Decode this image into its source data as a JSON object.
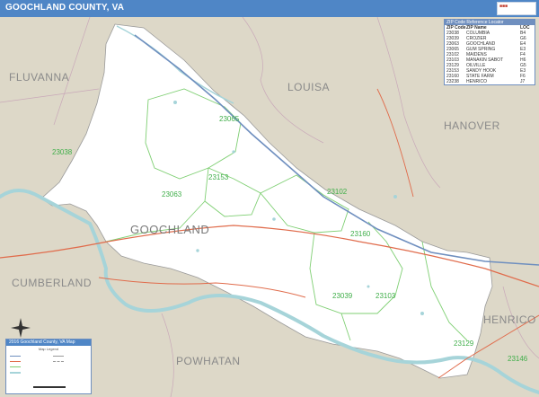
{
  "title": "GOOCHLAND COUNTY, VA",
  "colors": {
    "title_bar": "#4f86c6",
    "land": "#ddd8c8",
    "county_fill": "#ffffff",
    "water": "#a6d4d9",
    "zip_boundary": "#7fcf73",
    "highway": "#e06b4b",
    "interstate": "#6f8fbf"
  },
  "regions": [
    "FLUVANNA",
    "LOUISA",
    "HANOVER",
    "CUMBERLAND",
    "POWHATAN",
    "HENRICO"
  ],
  "county_label": "GOOCHLAND",
  "zip_codes": [
    "23038",
    "23063",
    "23065",
    "23153",
    "23102",
    "23160",
    "23039",
    "23103",
    "23129",
    "23146"
  ],
  "zip_table": {
    "heading": "ZIP Code Reference Locator",
    "columns": [
      "ZIP Code",
      "ZIP Name",
      "LOC"
    ],
    "rows": [
      [
        "23038",
        "COLUMBIA",
        "B4"
      ],
      [
        "23039",
        "CROZIER",
        "G6"
      ],
      [
        "23063",
        "GOOCHLAND",
        "E4"
      ],
      [
        "23065",
        "GUM SPRING",
        "E3"
      ],
      [
        "23102",
        "MAIDENS",
        "F4"
      ],
      [
        "23103",
        "MANAKIN SABOT",
        "H6"
      ],
      [
        "23129",
        "OILVILLE",
        "G5"
      ],
      [
        "23153",
        "SANDY HOOK",
        "E3"
      ],
      [
        "23160",
        "STATE FARM",
        "F6"
      ],
      [
        "23238",
        "HENRICO",
        "J7"
      ]
    ]
  },
  "legend": {
    "heading": "2016 Goochland County, VA Map",
    "subheading": "Map Legend"
  }
}
